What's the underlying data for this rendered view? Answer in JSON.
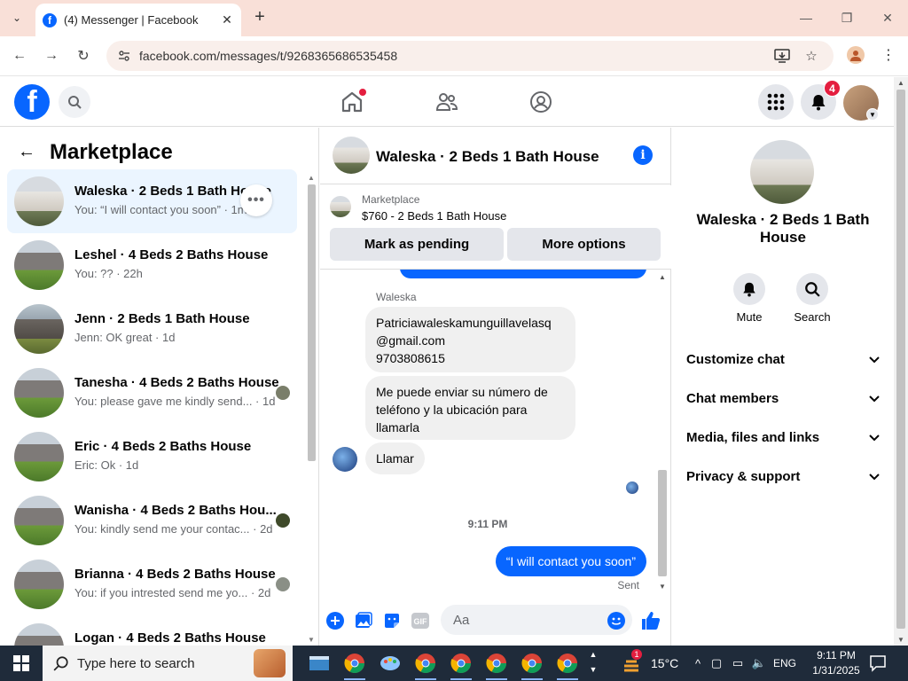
{
  "browser": {
    "tab_title": "(4) Messenger | Facebook",
    "url": "facebook.com/messages/t/9268365686535458"
  },
  "fb_header": {
    "notification_count": "4"
  },
  "left": {
    "title": "Marketplace",
    "conversations": [
      {
        "name": "Waleska · 2 Beds 1 Bath House",
        "snippet": "You: “I will contact you soon” · 1m",
        "active": true
      },
      {
        "name": "Leshel · 4 Beds 2 Baths House",
        "snippet": "You: ?? · 22h"
      },
      {
        "name": "Jenn · 2 Beds 1 Bath House",
        "snippet": "Jenn: OK great · 1d"
      },
      {
        "name": "Tanesha · 4 Beds 2 Baths House",
        "snippet": "You: please gave me kindly send... · 1d"
      },
      {
        "name": "Eric · 4 Beds 2 Baths House",
        "snippet": "Eric: Ok · 1d"
      },
      {
        "name": "Wanisha · 4 Beds 2 Baths Hou...",
        "snippet": "You: kindly send me your contac... · 2d"
      },
      {
        "name": "Brianna · 4 Beds 2 Baths House",
        "snippet": "You: if you intrested send me yo... · 2d"
      },
      {
        "name": "Logan · 4 Beds 2 Baths House",
        "snippet": ""
      }
    ]
  },
  "chat": {
    "title": "Waleska · 2 Beds 1 Bath House",
    "marketplace_label": "Marketplace",
    "listing": "$760 - 2 Beds 1 Bath House",
    "mark_pending_label": "Mark as pending",
    "more_options_label": "More options",
    "sender_name": "Waleska",
    "msg1": "Patriciawaleskamunguillavelasq\n@gmail.com\n9703808615",
    "msg2": "Me puede enviar su número  de\nteléfono  y la ubicación  para\nllamarla",
    "msg3": "Llamar",
    "time": "9:11 PM",
    "out_msg": "“I will contact you soon”",
    "sent_label": "Sent",
    "composer_placeholder": "Aa"
  },
  "right": {
    "name": "Waleska · 2 Beds 1 Bath House",
    "mute_label": "Mute",
    "search_label": "Search",
    "sections": [
      "Customize chat",
      "Chat members",
      "Media, files and links",
      "Privacy & support"
    ]
  },
  "taskbar": {
    "search_placeholder": "Type here to search",
    "temperature": "15°C",
    "language": "ENG",
    "time": "9:11 PM",
    "date": "1/31/2025",
    "weather_badge": "1"
  },
  "colors": {
    "fb_blue": "#0866ff",
    "notif_red": "#e41e3f",
    "active_row": "#ebf5ff"
  }
}
